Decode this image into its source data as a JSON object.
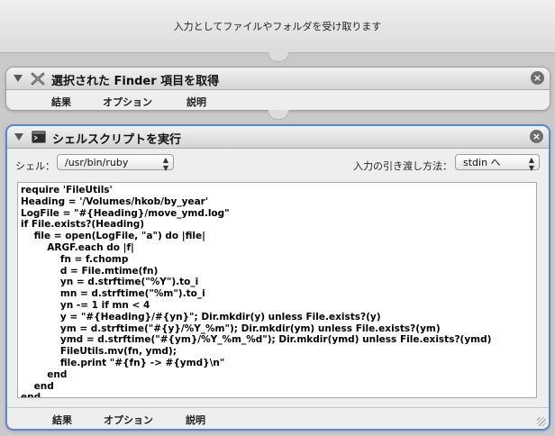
{
  "workflow": {
    "input_label": "入力としてファイルやフォルダを受け取ります"
  },
  "action1": {
    "title": "選択された Finder 項目を取得",
    "icon": "finder-x-icon",
    "tabs": [
      "結果",
      "オプション",
      "説明"
    ]
  },
  "action2": {
    "title": "シェルスクリプトを実行",
    "icon": "terminal-icon",
    "shell_label": "シェル：",
    "shell_value": "/usr/bin/ruby",
    "pass_input_label": "入力の引き渡し方法：",
    "pass_input_value": "stdin へ",
    "script_lines": [
      "require 'FileUtils'",
      "Heading = '/Volumes/hkob/by_year'",
      "LogFile = \"#{Heading}/move_ymd.log\"",
      "if File.exists?(Heading)",
      "\tfile = open(LogFile, \"a\") do |file|",
      "\t\tARGF.each do |f|",
      "\t\t\tfn = f.chomp",
      "\t\t\td = File.mtime(fn)",
      "\t\t\tyn = d.strftime(\"%Y\").to_i",
      "\t\t\tmn = d.strftime(\"%m\").to_i",
      "\t\t\tyn -= 1 if mn < 4",
      "\t\t\ty = \"#{Heading}/#{yn}\"; Dir.mkdir(y) unless File.exists?(y)",
      "\t\t\tym = d.strftime(\"#{y}/%Y_%m\"); Dir.mkdir(ym) unless File.exists?(ym)",
      "\t\t\tymd = d.strftime(\"#{ym}/%Y_%m_%d\"); Dir.mkdir(ymd) unless File.exists?(ymd)",
      "\t\t\tFileUtils.mv(fn, ymd);",
      "\t\t\tfile.print \"#{fn} -> #{ymd}\\n\"",
      "\t\tend",
      "\tend",
      "end"
    ],
    "tabs": [
      "結果",
      "オプション",
      "説明"
    ]
  },
  "colors": {
    "selection_border": "#5b86d6",
    "background": "#c9c9c9"
  }
}
